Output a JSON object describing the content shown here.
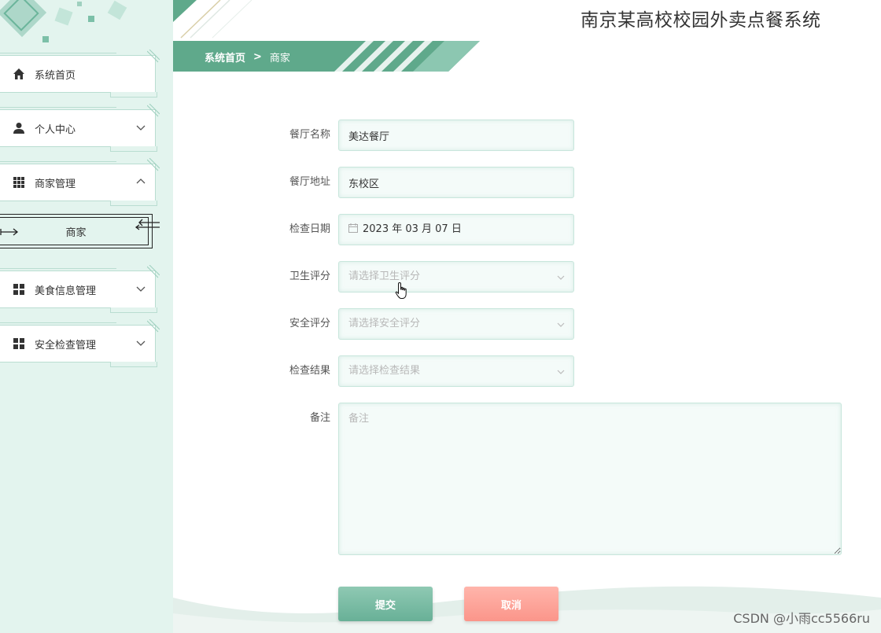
{
  "app": {
    "title": "南京某高校校园外卖点餐系统"
  },
  "breadcrumb": {
    "home": "系统首页",
    "separator": ">",
    "current": "商家"
  },
  "sidebar": {
    "items": [
      {
        "label": "系统首页",
        "icon": "home-icon",
        "expandable": false
      },
      {
        "label": "个人中心",
        "icon": "user-icon",
        "expandable": true,
        "expanded": false
      },
      {
        "label": "商家管理",
        "icon": "grid-icon",
        "expandable": true,
        "expanded": true
      },
      {
        "label": "美食信息管理",
        "icon": "apps-icon",
        "expandable": true,
        "expanded": false
      },
      {
        "label": "安全检查管理",
        "icon": "apps-icon",
        "expandable": true,
        "expanded": false
      }
    ],
    "submenu": {
      "label": "商家"
    }
  },
  "form": {
    "restaurant_name": {
      "label": "餐厅名称",
      "value": "美达餐厅"
    },
    "restaurant_address": {
      "label": "餐厅地址",
      "value": "东校区"
    },
    "inspection_date": {
      "label": "检查日期",
      "value": "2023 年 03 月 07 日"
    },
    "hygiene_rating": {
      "label": "卫生评分",
      "placeholder": "请选择卫生评分"
    },
    "safety_rating": {
      "label": "安全评分",
      "placeholder": "请选择安全评分"
    },
    "inspection_result": {
      "label": "检查结果",
      "placeholder": "请选择检查结果"
    },
    "remarks": {
      "label": "备注",
      "placeholder": "备注"
    },
    "submit_label": "提交",
    "cancel_label": "取消"
  },
  "watermark": "CSDN @小雨cc5566ru",
  "colors": {
    "accent": "#5fa98b",
    "sidebar_bg": "#e3f4ee",
    "cancel": "#fb958a"
  }
}
